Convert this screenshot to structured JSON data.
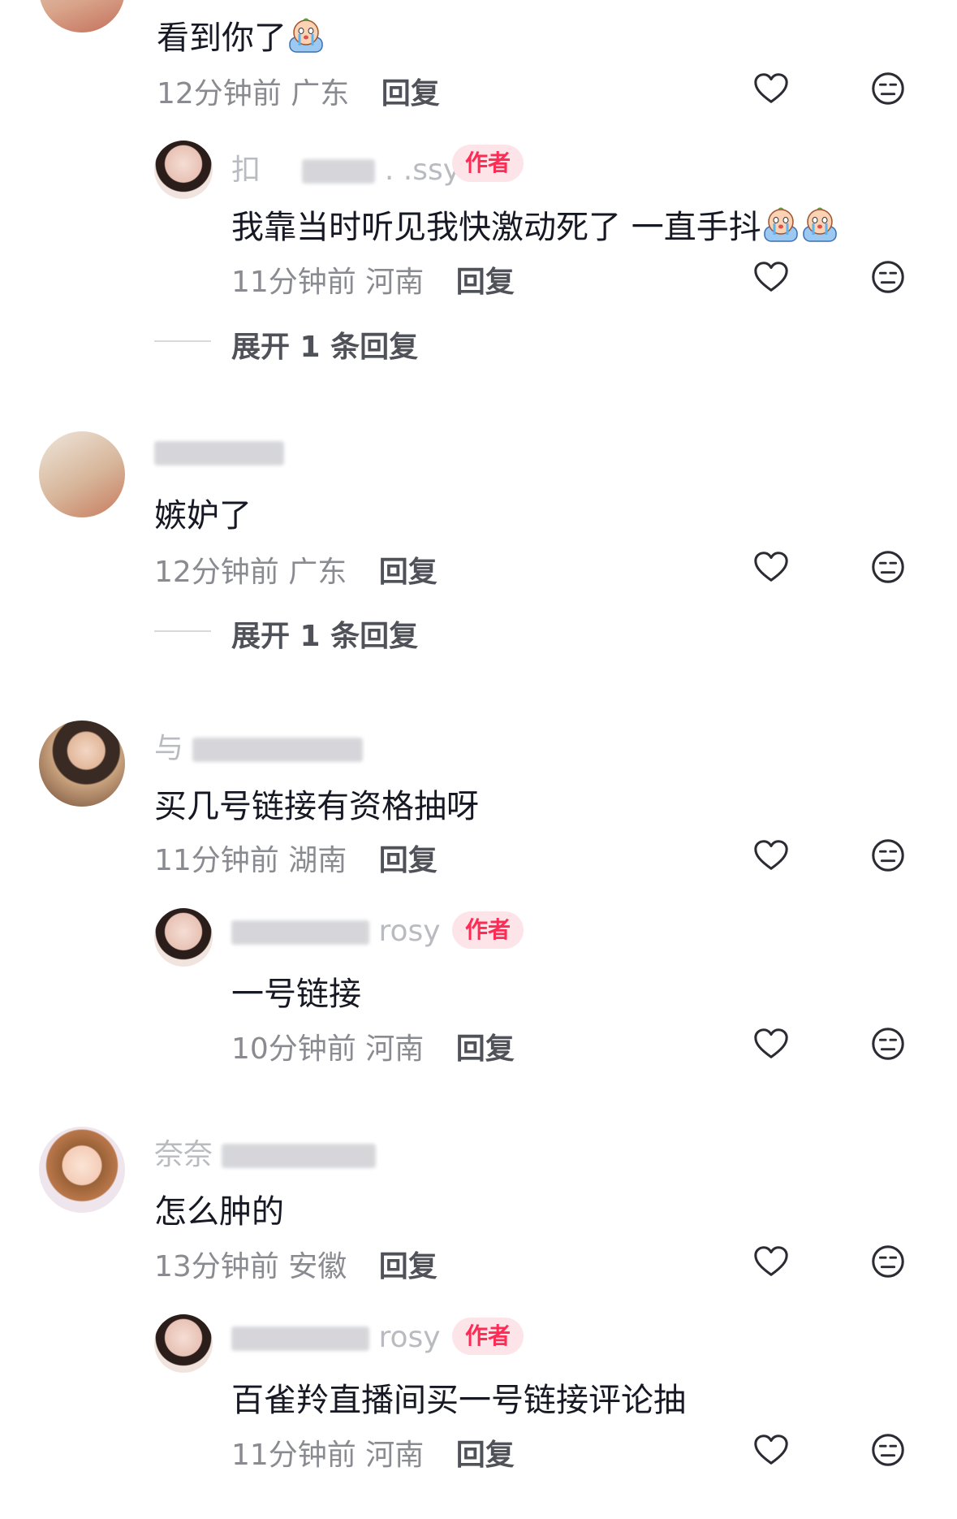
{
  "comments": [
    {
      "content": "看到你了",
      "time": "12分钟前",
      "location": "广东",
      "reply_label": "回复",
      "replies": [
        {
          "username": "扣",
          "username_tail": ". .ssy",
          "author_badge": "作者",
          "content": "我靠当时听见我快激动死了 一直手抖",
          "time": "11分钟前",
          "location": "河南",
          "reply_label": "回复"
        }
      ],
      "expand_label": "展开 1 条回复"
    },
    {
      "username": "",
      "content": "嫉妒了",
      "time": "12分钟前",
      "location": "广东",
      "reply_label": "回复",
      "expand_label": "展开 1 条回复"
    },
    {
      "username": "与",
      "content": "买几号链接有资格抽呀",
      "time": "11分钟前",
      "location": "湖南",
      "reply_label": "回复",
      "replies": [
        {
          "username": "",
          "username_tail": "rosy",
          "author_badge": "作者",
          "content": "一号链接",
          "time": "10分钟前",
          "location": "河南",
          "reply_label": "回复"
        }
      ]
    },
    {
      "username": "奈奈",
      "content": "怎么肿的",
      "time": "13分钟前",
      "location": "安徽",
      "reply_label": "回复",
      "replies": [
        {
          "username": "",
          "username_tail": "rosy",
          "author_badge": "作者",
          "content": "百雀羚直播间买一号链接评论抽",
          "time": "11分钟前",
          "location": "河南",
          "reply_label": "回复"
        }
      ]
    }
  ],
  "icons": {
    "like": "heart-outline-icon",
    "dislike": "neutral-face-icon",
    "emoji": "crying-baby-emoji"
  },
  "colors": {
    "author_badge_bg": "#fde4e8",
    "author_badge_text": "#fe2c55",
    "meta": "#8a8b91"
  }
}
